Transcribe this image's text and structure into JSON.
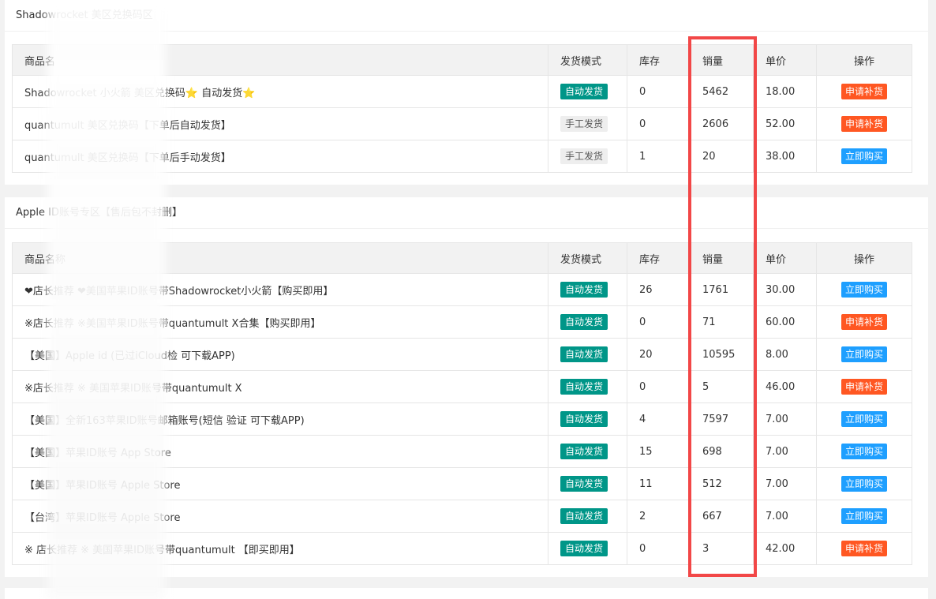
{
  "sections": [
    {
      "title": "Shadowrocket 美区兑换码区",
      "headers": [
        "商品名",
        "发货模式",
        "库存",
        "销量",
        "单价",
        "操作"
      ],
      "rows": [
        {
          "name": "Shadowrocket 小火箭 美区兑换码⭐ 自动发货⭐",
          "mode": "自动发货",
          "stock": "0",
          "sales": "5462",
          "price": "18.00",
          "action": "申请补货"
        },
        {
          "name": "quantumult 美区兑换码【下单后自动发货】",
          "mode": "手工发货",
          "stock": "0",
          "sales": "2606",
          "price": "52.00",
          "action": "申请补货"
        },
        {
          "name": "quantumult 美区兑换码【下单后手动发货】",
          "mode": "手工发货",
          "stock": "1",
          "sales": "20",
          "price": "38.00",
          "action": "立即购买"
        }
      ]
    },
    {
      "title": "Apple ID账号专区【售后包不封删】",
      "headers": [
        "商品名称",
        "发货模式",
        "库存",
        "销量",
        "单价",
        "操作"
      ],
      "rows": [
        {
          "name": "❤店长推荐 ❤美国苹果ID账号带Shadowrocket小火箭【购买即用】",
          "mode": "自动发货",
          "stock": "26",
          "sales": "1761",
          "price": "30.00",
          "action": "立即购买"
        },
        {
          "name": "※店长推荐 ※美国苹果ID账号带quantumult X合集【购买即用】",
          "mode": "自动发货",
          "stock": "0",
          "sales": "71",
          "price": "60.00",
          "action": "申请补货"
        },
        {
          "name": "【美国】Apple id (已过iCloud检 可下载APP)",
          "mode": "自动发货",
          "stock": "20",
          "sales": "10595",
          "price": "8.00",
          "action": "立即购买"
        },
        {
          "name": "※店长推荐 ※ 美国苹果ID账号带quantumult X",
          "mode": "自动发货",
          "stock": "0",
          "sales": "5",
          "price": "46.00",
          "action": "申请补货"
        },
        {
          "name": "【美国】全新163苹果ID账号邮箱账号(短信 验证 可下载APP)",
          "mode": "自动发货",
          "stock": "4",
          "sales": "7597",
          "price": "7.00",
          "action": "立即购买"
        },
        {
          "name": "【美国】苹果ID账号 App Store",
          "mode": "自动发货",
          "stock": "15",
          "sales": "698",
          "price": "7.00",
          "action": "立即购买"
        },
        {
          "name": "【美国】苹果ID账号 Apple Store",
          "mode": "自动发货",
          "stock": "11",
          "sales": "512",
          "price": "7.00",
          "action": "立即购买"
        },
        {
          "name": "【台湾】苹果ID账号 Apple Store",
          "mode": "自动发货",
          "stock": "2",
          "sales": "667",
          "price": "7.00",
          "action": "立即购买"
        },
        {
          "name": "※ 店长推荐 ※ 美国苹果ID账号带quantumult 【即买即用】",
          "mode": "自动发货",
          "stock": "0",
          "sales": "3",
          "price": "42.00",
          "action": "申请补货"
        }
      ]
    }
  ],
  "colors": {
    "auto_badge": "#009688",
    "restock_button": "#ff5722",
    "buy_button": "#1e9fff",
    "highlight_box": "#f24747"
  }
}
